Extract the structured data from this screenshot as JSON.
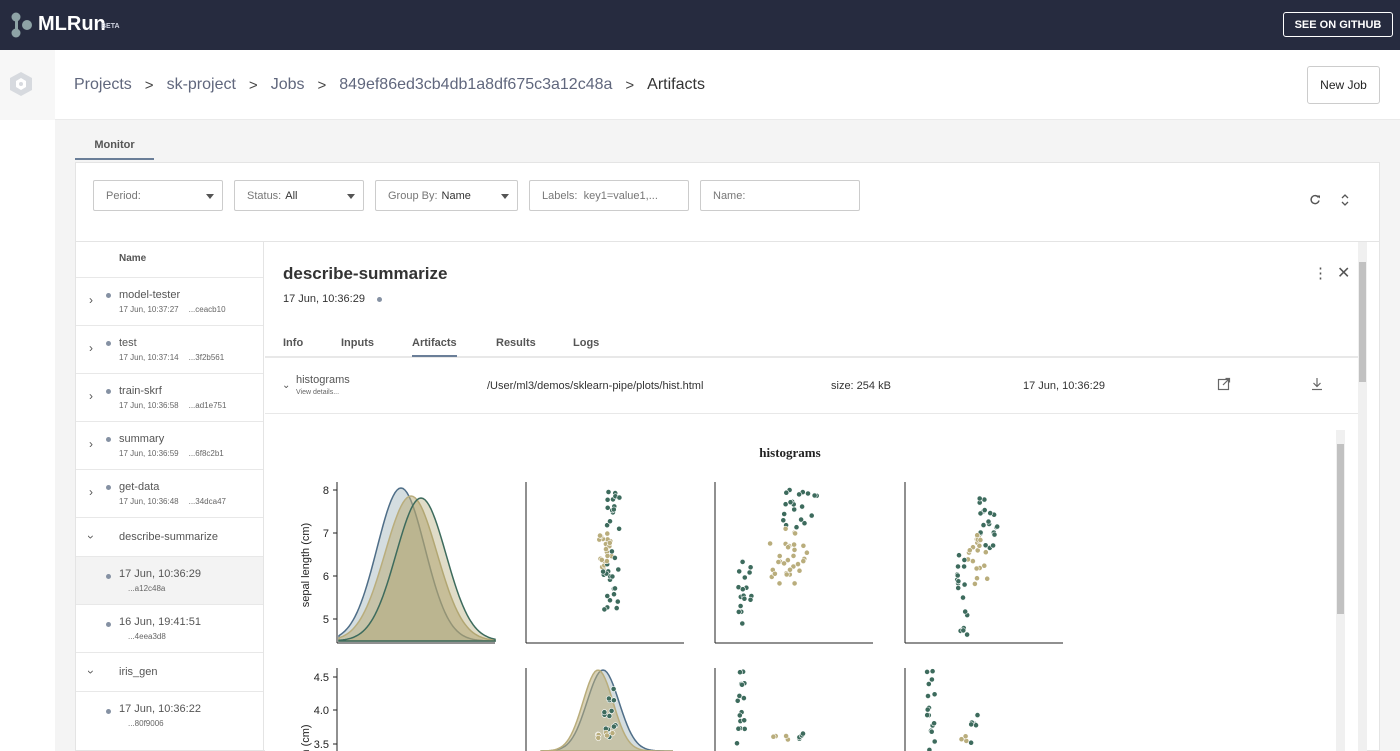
{
  "header": {
    "brand": "MLRun",
    "beta": "BETA",
    "github_button": "SEE ON GITHUB"
  },
  "breadcrumb": {
    "items": [
      "Projects",
      "sk-project",
      "Jobs",
      "849ef86ed3cb4db1a8df675c3a12c48a",
      "Artifacts"
    ],
    "separator": ">"
  },
  "new_job_button": "New Job",
  "monitor_tab": "Monitor",
  "filters": {
    "period_label": "Period:",
    "status_label": "Status:",
    "status_value": "All",
    "group_label": "Group By:",
    "group_value": "Name",
    "labels_placeholder": "Labels:  key1=value1,...",
    "name_placeholder": "Name:"
  },
  "list": {
    "header": "Name",
    "jobs": [
      {
        "name": "model-tester",
        "date": "17 Jun, 10:37:27",
        "uid": "...ceacb10"
      },
      {
        "name": "test",
        "date": "17 Jun, 10:37:14",
        "uid": "...3f2b561"
      },
      {
        "name": "train-skrf",
        "date": "17 Jun, 10:36:58",
        "uid": "...ad1e751"
      },
      {
        "name": "summary",
        "date": "17 Jun, 10:36:59",
        "uid": "...6f8c2b1"
      },
      {
        "name": "get-data",
        "date": "17 Jun, 10:36:48",
        "uid": "...34dca47"
      }
    ],
    "group_describe": {
      "name": "describe-summarize",
      "runs": [
        {
          "date": "17 Jun, 10:36:29",
          "uid": "...a12c48a"
        },
        {
          "date": "16 Jun, 19:41:51",
          "uid": "...4eea3d8"
        }
      ]
    },
    "group_iris": {
      "name": "iris_gen",
      "runs": [
        {
          "date": "17 Jun, 10:36:22",
          "uid": "...80f9006"
        }
      ]
    }
  },
  "detail": {
    "title": "describe-summarize",
    "date": "17 Jun, 10:36:29",
    "tabs": [
      "Info",
      "Inputs",
      "Artifacts",
      "Results",
      "Logs"
    ],
    "active_tab": "Artifacts",
    "artifact": {
      "name": "histograms",
      "view_details": "View details...",
      "path": "/User/ml3/demos/sklearn-pipe/plots/hist.html",
      "size": "size: 254 kB",
      "date": "17 Jun, 10:36:29"
    }
  },
  "chart_data": {
    "type": "scatter",
    "title": "histograms",
    "row_labels": [
      "sepal length (cm)",
      "h (cm)"
    ],
    "row1_yticks": [
      "8",
      "7",
      "6",
      "5"
    ],
    "row2_yticks": [
      "4.5",
      "4.0",
      "3.5"
    ],
    "row1_ylim": [
      4.3,
      8.0
    ],
    "row2_ylim": [
      3.4,
      4.5
    ],
    "colors": {
      "dark": "#3d6b5d",
      "tan": "#b9ad7c",
      "blue": "#4f6e88"
    }
  },
  "colors": {
    "topbar": "#262b3f",
    "accent": "#6a7e98"
  }
}
